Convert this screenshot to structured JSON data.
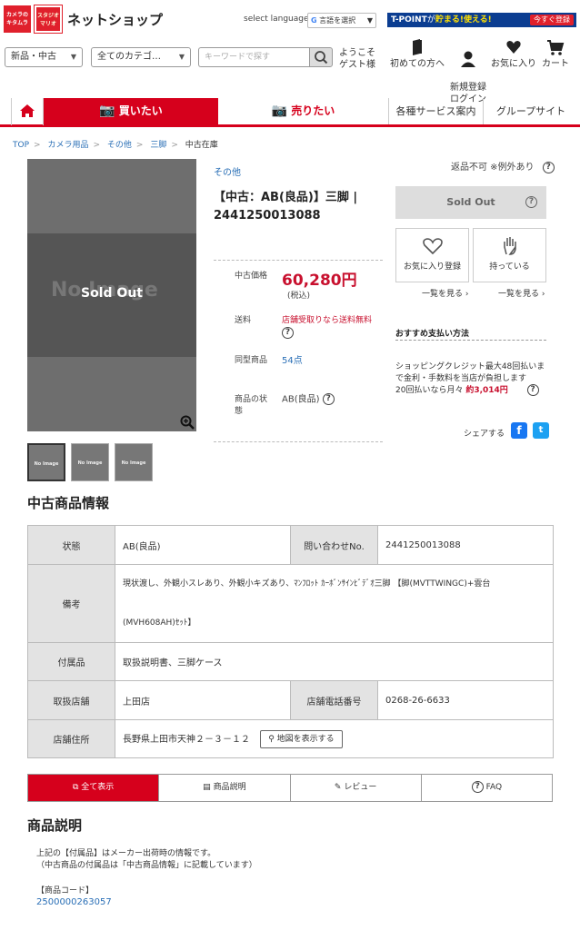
{
  "header": {
    "logo1_text": "カメラの\nキタムラ",
    "logo2_text": "スタジオ\nマリオ",
    "shop_name": "ネットショップ",
    "lang_label": "select language",
    "lang_select": "言語を選択",
    "tpoint": {
      "brand": "T-POINT",
      "text1": "が",
      "text2": "貯まる!使える!",
      "btn": "今すぐ登録"
    },
    "cond_select": "新品・中古",
    "cat_select": "全てのカテゴ…",
    "search_placeholder": "キーワードで探す",
    "welcome_line1": "ようこそ",
    "welcome_line2": "ゲスト様",
    "nav": [
      {
        "label": "初めての方へ"
      },
      {
        "label": "新規登録\nログイン"
      },
      {
        "label": "お気に入り"
      },
      {
        "label": "カート"
      }
    ]
  },
  "main_nav": {
    "buy": "買いたい",
    "sell": "売りたい",
    "services": "各種サービス案内",
    "group": "グループサイト"
  },
  "breadcrumb": [
    "TOP",
    "カメラ用品",
    "その他",
    "三脚",
    "中古在庫"
  ],
  "image": {
    "no_image": "No Image",
    "sold_out": "Sold Out",
    "thumb_text": "No Image"
  },
  "product": {
    "category": "その他",
    "title": "【中古：AB(良品)】三脚 | 2441250013088",
    "price_label": "中古価格",
    "price": "60,280円",
    "tax": "(税込)",
    "shipping_label": "送料",
    "shipping_value": "店舗受取りなら送料無料",
    "same_label": "同型商品",
    "same_value": "54点",
    "state_label": "商品の状態",
    "state_value": "AB(良品)"
  },
  "side": {
    "return_note": "返品不可 ※例外あり",
    "sold_out": "Sold Out",
    "fav_label": "お気に入り登録",
    "have_label": "持っている",
    "list_link": "一覧を見る",
    "reco_title": "おすすめ支払い方法",
    "reco_text1": "ショッピングクレジット最大48回払いまで金利・手数料を当店が負担します",
    "reco_text2": "20回払いなら月々",
    "reco_amount": "約3,014円",
    "share": "シェアする"
  },
  "used_info": {
    "title": "中古商品情報",
    "rows": {
      "state_label": "状態",
      "state_value": "AB(良品)",
      "inq_label": "問い合わせNo.",
      "inq_value": "2441250013088",
      "note_label": "備考",
      "note_value1": "現状渡し、外観小スレあり、外観小キズあり、ﾏﾝﾌﾛｯﾄ ｶｰﾎﾞﾝｻｲﾝﾋﾞﾃﾞｵ三脚 【脚(MVTTWINGC)+雲台",
      "note_value2": "(MVH608AH)ｾｯﾄ】",
      "acc_label": "付属品",
      "acc_value": "取扱説明書、三脚ケース",
      "store_label": "取扱店舗",
      "store_value": "上田店",
      "tel_label": "店舗電話番号",
      "tel_value": "0268-26-6633",
      "addr_label": "店舗住所",
      "addr_value": "長野県上田市天神２－３－１２",
      "map_btn": "地図を表示する"
    }
  },
  "tabs": [
    "全て表示",
    "商品説明",
    "レビュー",
    "FAQ"
  ],
  "description": {
    "title": "商品説明",
    "line1": "上記の【付属品】はメーカー出荷時の情報です。",
    "line2": "（中古商品の付属品は「中古商品情報」に記載しています）",
    "code_label": "【商品コード】",
    "code": "2500000263057"
  }
}
